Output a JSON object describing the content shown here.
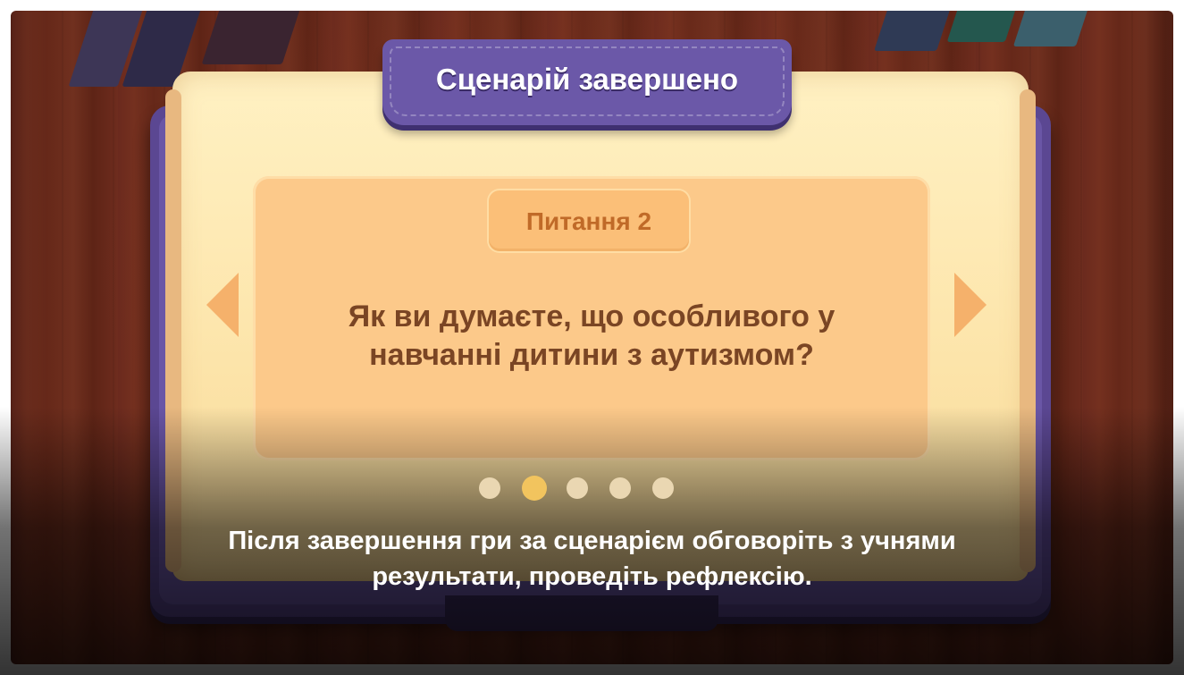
{
  "header": {
    "title": "Сценарій завершено"
  },
  "question": {
    "badge": "Питання 2",
    "text_line1": "Як ви думаєте, що особливого у",
    "text_line2": "навчанні дитини з аутизмом?"
  },
  "pager": {
    "count": 5,
    "active_index": 1
  },
  "subtitle": {
    "line1": "Після завершення гри за сценарієм обговоріть з учнями",
    "line2": "результати, проведіть рефлексію."
  },
  "colors": {
    "banner": "#6b58a8",
    "card": "#fcc98a",
    "badge_text": "#c06a28",
    "question_text": "#7a4524",
    "arrow": "#f5b16b"
  },
  "icons": {
    "prev": "chevron-left-icon",
    "next": "chevron-right-icon"
  }
}
